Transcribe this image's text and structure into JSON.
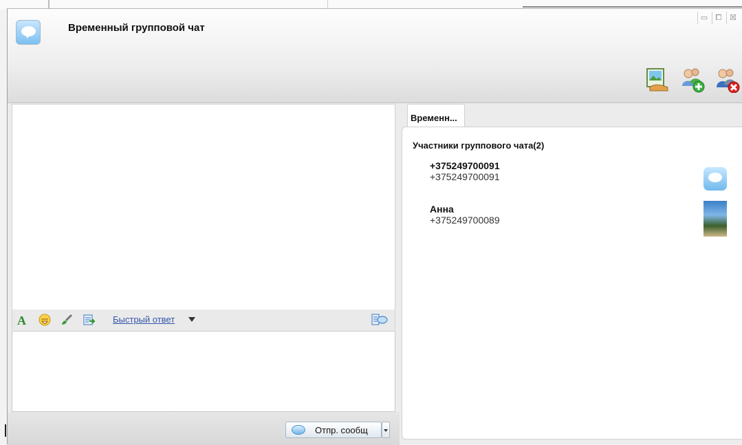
{
  "window": {
    "title": "Временный групповой чат",
    "controls": [
      "▭",
      "⧠",
      "☒"
    ]
  },
  "toolbar": {
    "icons": [
      "share-picture-icon",
      "add-members-icon",
      "remove-members-icon"
    ]
  },
  "format_bar": {
    "icons": [
      "font-color-icon",
      "emoticon-icon",
      "brush-icon",
      "quick-reply-icon",
      "history-icon"
    ],
    "quick_reply_label": "Быстрый ответ"
  },
  "send": {
    "label": "Отпр. сообщ"
  },
  "right_panel": {
    "tab_label": "Временн...",
    "members_title": "Участники группового чата(2)",
    "members": [
      {
        "name": "+375249700091",
        "number": "+375249700091",
        "avatar": "chat-bubble-avatar"
      },
      {
        "name": "Анна",
        "number": "+375249700089",
        "avatar": "beach-photo-avatar"
      }
    ]
  },
  "colors": {
    "link": "#3355aa",
    "accent_blue": "#6fb9ec"
  }
}
